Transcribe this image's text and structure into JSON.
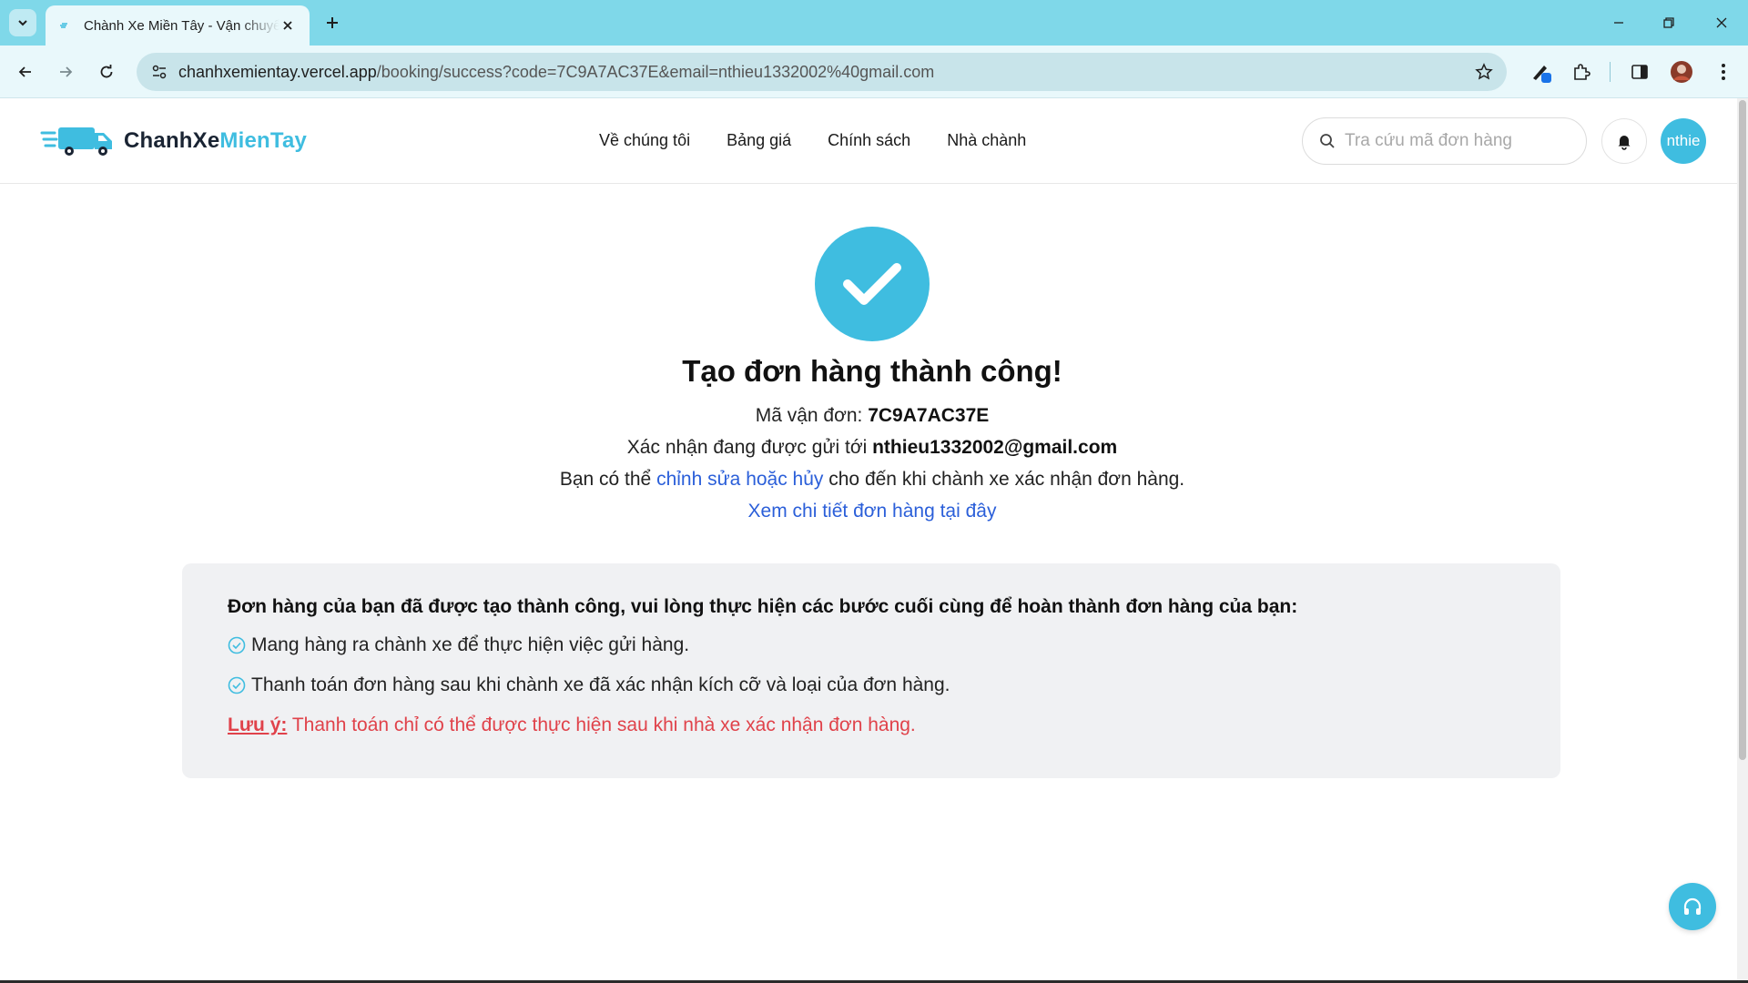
{
  "browser": {
    "tab_title": "Chành Xe Miền Tây - Vận chuyển",
    "url_host": "chanhxemientay.vercel.app",
    "url_path": "/booking/success?code=7C9A7AC37E&email=nthieu1332002%40gmail.com"
  },
  "header": {
    "logo_part1": "ChanhXe",
    "logo_part2": "MienTay",
    "nav": [
      "Về chúng tôi",
      "Bảng giá",
      "Chính sách",
      "Nhà chành"
    ],
    "search_placeholder": "Tra cứu mã đơn hàng",
    "avatar_text": "nthie"
  },
  "success": {
    "title": "Tạo đơn hàng thành công!",
    "code_label": "Mã vận đơn: ",
    "code_value": "7C9A7AC37E",
    "email_label": "Xác nhận đang được gửi tới ",
    "email_value": "nthieu1332002@gmail.com",
    "edit_prefix": "Bạn có thể ",
    "edit_link": "chỉnh sửa hoặc hủy",
    "edit_suffix": " cho đến khi chành xe xác nhận đơn hàng.",
    "detail_link": "Xem chi tiết đơn hàng tại đây"
  },
  "notice": {
    "heading": "Đơn hàng của bạn đã được tạo thành công, vui lòng thực hiện các bước cuối cùng để hoàn thành đơn hàng của bạn:",
    "steps": [
      "Mang hàng ra chành xe để thực hiện việc gửi hàng.",
      "Thanh toán đơn hàng sau khi chành xe đã xác nhận kích cỡ và loại của đơn hàng."
    ],
    "note_label": "Lưu ý:",
    "note_text": " Thanh toán chỉ có thể được thực hiện sau khi nhà xe xác nhận đơn hàng."
  },
  "colors": {
    "accent": "#3fbde0",
    "link": "#2b5fd9",
    "warning": "#e0424a",
    "chrome": "#7fd8e9"
  }
}
